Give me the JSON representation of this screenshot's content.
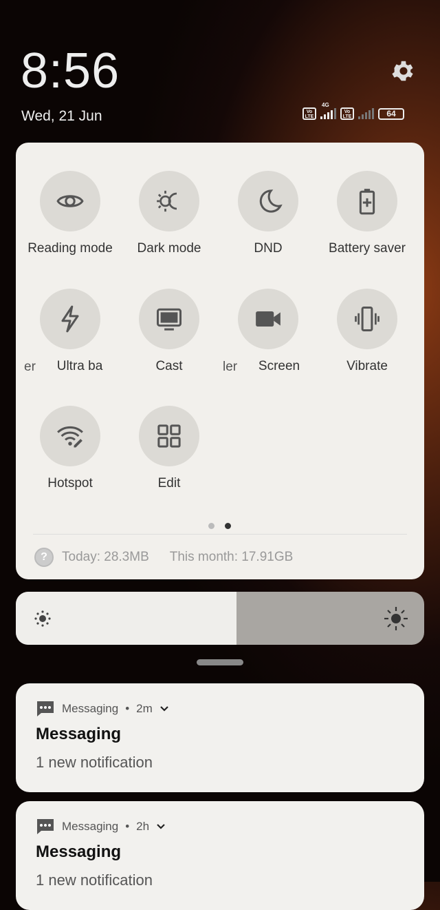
{
  "clock": {
    "time": "8:56",
    "date": "Wed, 21 Jun"
  },
  "status": {
    "sim1_label": "Vo LTE",
    "network_type": "4G",
    "sim2_label": "Vo LTE",
    "battery": "64"
  },
  "tiles": [
    {
      "label": "Reading mode",
      "icon": "eye-icon"
    },
    {
      "label": "Dark mode",
      "icon": "dark-mode-icon"
    },
    {
      "label": "DND",
      "icon": "moon-icon"
    },
    {
      "label": "Battery saver",
      "icon": "battery-plus-icon"
    },
    {
      "label": "Ultra ba",
      "icon": "lightning-icon"
    },
    {
      "label": "Cast",
      "icon": "monitor-icon"
    },
    {
      "label": "Screen",
      "icon": "video-camera-icon"
    },
    {
      "label": "Vibrate",
      "icon": "vibrate-icon"
    },
    {
      "label": "Hotspot",
      "icon": "hotspot-icon"
    },
    {
      "label": "Edit",
      "icon": "grid-icon"
    }
  ],
  "clipped_labels": [
    "er",
    "ler"
  ],
  "pager": {
    "pages": 2,
    "current": 2
  },
  "usage": {
    "today": "Today: 28.3MB",
    "month": "This month: 17.91GB"
  },
  "brightness": {
    "level_percent": 54
  },
  "notifications": [
    {
      "app": "Messaging",
      "time": "2m",
      "title": "Messaging",
      "body": "1 new notification"
    },
    {
      "app": "Messaging",
      "time": "2h",
      "title": "Messaging",
      "body": "1 new notification"
    }
  ]
}
